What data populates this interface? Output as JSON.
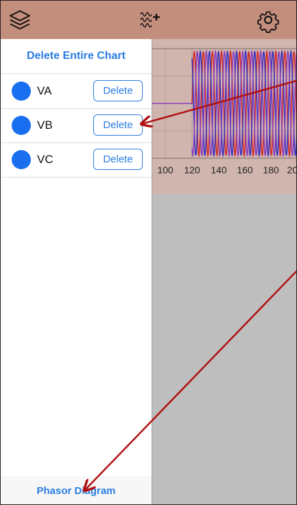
{
  "toolbar": {
    "icons": [
      "layers-icon",
      "waveform-add-icon",
      "gear-icon"
    ]
  },
  "sidebar": {
    "delete_all_label": "Delete Entire Chart",
    "channels": [
      {
        "label": "VA",
        "button": "Delete",
        "color": "#1a6ff0"
      },
      {
        "label": "VB",
        "button": "Delete",
        "color": "#1a6ff0"
      },
      {
        "label": "VC",
        "button": "Delete",
        "color": "#1a6ff0"
      }
    ],
    "footer_label": "Phasor Diagram"
  },
  "chart": {
    "x_ticks": [
      "100",
      "120",
      "140",
      "160",
      "180",
      "20"
    ],
    "series_colors": [
      "#d12a2a",
      "#3a2fc2",
      "#8a3fbf"
    ]
  },
  "annotations": {
    "arrow_color": "#b01010"
  }
}
